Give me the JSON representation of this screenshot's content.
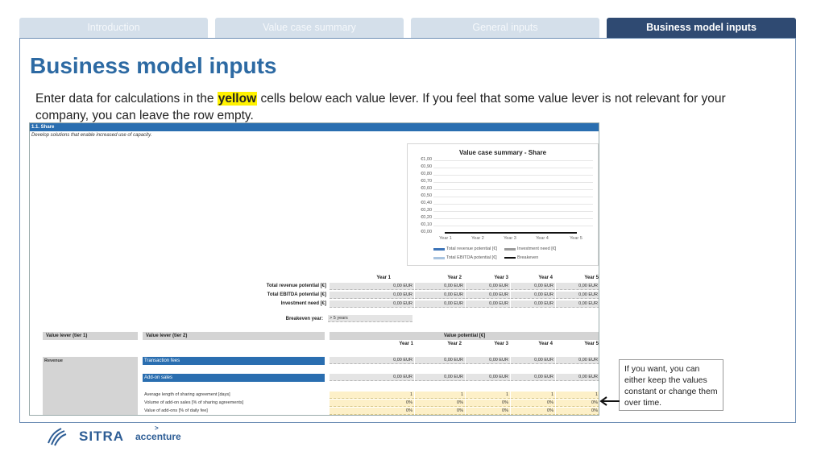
{
  "tabs": [
    {
      "label": "Introduction",
      "active": false
    },
    {
      "label": "Value case summary",
      "active": false
    },
    {
      "label": "General inputs",
      "active": false
    },
    {
      "label": "Business model inputs",
      "active": true
    }
  ],
  "page_title": "Business model inputs",
  "instructions": {
    "before": "Enter data for calculations in the ",
    "highlight": "yellow",
    "after": " cells below each value lever. If you feel that some value lever is not relevant for your company, you can leave the row empty."
  },
  "sheet": {
    "section_title": "1.1. Share",
    "section_desc": "Develop solutions that enable increased use of capacity.",
    "chart": {
      "title": "Value case summary - Share",
      "y_ticks": [
        "€1,00",
        "€0,90",
        "€0,80",
        "€0,70",
        "€0,60",
        "€0,50",
        "€0,40",
        "€0,30",
        "€0,20",
        "€0,10",
        "€0,00"
      ],
      "x_ticks": [
        "Year 1",
        "Year 2",
        "Year 3",
        "Year 4",
        "Year 5"
      ],
      "legend": [
        "Total revenue potential [€]",
        "Investment need [€]",
        "Total EBITDA potential [€]",
        "Breakeven"
      ]
    },
    "summary": {
      "years": [
        "Year 1",
        "Year 2",
        "Year 3",
        "Year 4",
        "Year 5"
      ],
      "rows": [
        {
          "label": "Total revenue potential [€]",
          "values": [
            "0,00 EUR",
            "0,00 EUR",
            "0,00 EUR",
            "0,00 EUR",
            "0,00 EUR"
          ]
        },
        {
          "label": "Total EBITDA potential [€]",
          "values": [
            "0,00 EUR",
            "0,00 EUR",
            "0,00 EUR",
            "0,00 EUR",
            "0,00 EUR"
          ]
        },
        {
          "label": "Investment need [€]",
          "values": [
            "0,00 EUR",
            "0,00 EUR",
            "0,00 EUR",
            "0,00 EUR",
            "0,00 EUR"
          ]
        }
      ],
      "breakeven_label": "Breakeven year:",
      "breakeven_value": "> 5 years"
    },
    "levers": {
      "tier1_header": "Value lever (tier 1)",
      "tier2_header": "Value lever (tier 2)",
      "potential_header": "Value potential [€]",
      "years": [
        "Year 1",
        "Year 2",
        "Year 3",
        "Year 4",
        "Year 5"
      ],
      "tier1_label": "Revenue",
      "rows": [
        {
          "label": "Transaction fees",
          "values": [
            "0,00 EUR",
            "0,00 EUR",
            "0,00 EUR",
            "0,00 EUR",
            "0,00 EUR"
          ]
        },
        {
          "label": "Add-on sales",
          "values": [
            "0,00 EUR",
            "0,00 EUR",
            "0,00 EUR",
            "0,00 EUR",
            "0,00 EUR"
          ]
        }
      ],
      "inputs": [
        {
          "label": "Average length of sharing agreement [days]",
          "values": [
            "1",
            "1",
            "1",
            "1",
            "1"
          ]
        },
        {
          "label": "Volume of add-on sales [% of sharing agreements]",
          "values": [
            "0%",
            "0%",
            "0%",
            "0%",
            "0%"
          ]
        },
        {
          "label": "Value of add-ons [% of daily fee]",
          "values": [
            "0%",
            "0%",
            "0%",
            "0%",
            "0%"
          ]
        }
      ]
    }
  },
  "callout": "If you want, you can either keep the values constant or change them over time.",
  "footer": {
    "sitra": "SITRA",
    "accenture": "accenture"
  },
  "colors": {
    "active_tab": "#2f4a72",
    "inactive_tab": "#d4dfea",
    "title_blue": "#2d6aa3",
    "yellow_input": "#fdf0c8",
    "highlight": "#fff200"
  }
}
